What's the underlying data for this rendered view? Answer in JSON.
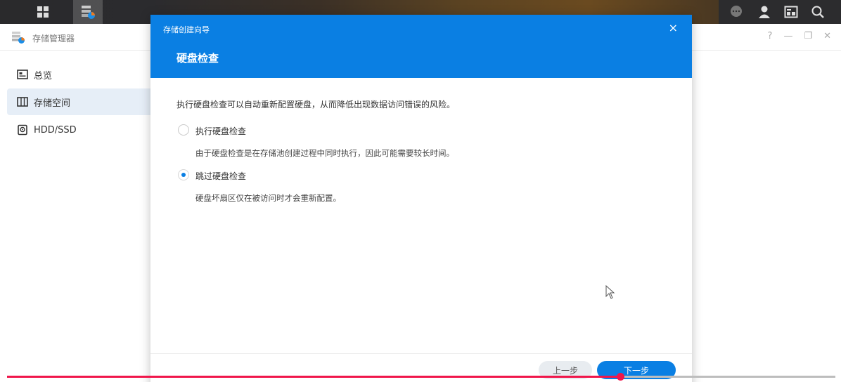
{
  "taskbar": {
    "left_icons": [
      "main-menu-icon",
      "storage-manager-app-icon"
    ],
    "right_icons": [
      "chat-icon",
      "user-icon",
      "widgets-icon",
      "search-icon"
    ]
  },
  "app": {
    "title": "存储管理器",
    "window_controls": [
      "?",
      "—",
      "❐",
      "✕"
    ]
  },
  "sidebar": {
    "items": [
      {
        "label": "总览",
        "icon": "overview-icon"
      },
      {
        "label": "存储空间",
        "icon": "storage-icon",
        "selected": true
      },
      {
        "label": "HDD/SSD",
        "icon": "disk-icon"
      }
    ]
  },
  "dialog": {
    "caption": "存储创建向导",
    "close": "×",
    "title": "硬盘检查",
    "description": "执行硬盘检查可以自动重新配置硬盘，从而降低出现数据访问错误的风险。",
    "options": [
      {
        "label": "执行硬盘检查",
        "desc": "由于硬盘检查是在存储池创建过程中同时执行，因此可能需要较长时间。",
        "selected": false
      },
      {
        "label": "跳过硬盘检查",
        "desc": "硬盘坏扇区仅在被访问时才会重新配置。",
        "selected": true
      }
    ],
    "prev_label": "上一步",
    "next_label": "下一步"
  },
  "video": {
    "progress": 0.74
  },
  "colors": {
    "accent": "#0a7fe3",
    "progress": "#f0164a"
  }
}
